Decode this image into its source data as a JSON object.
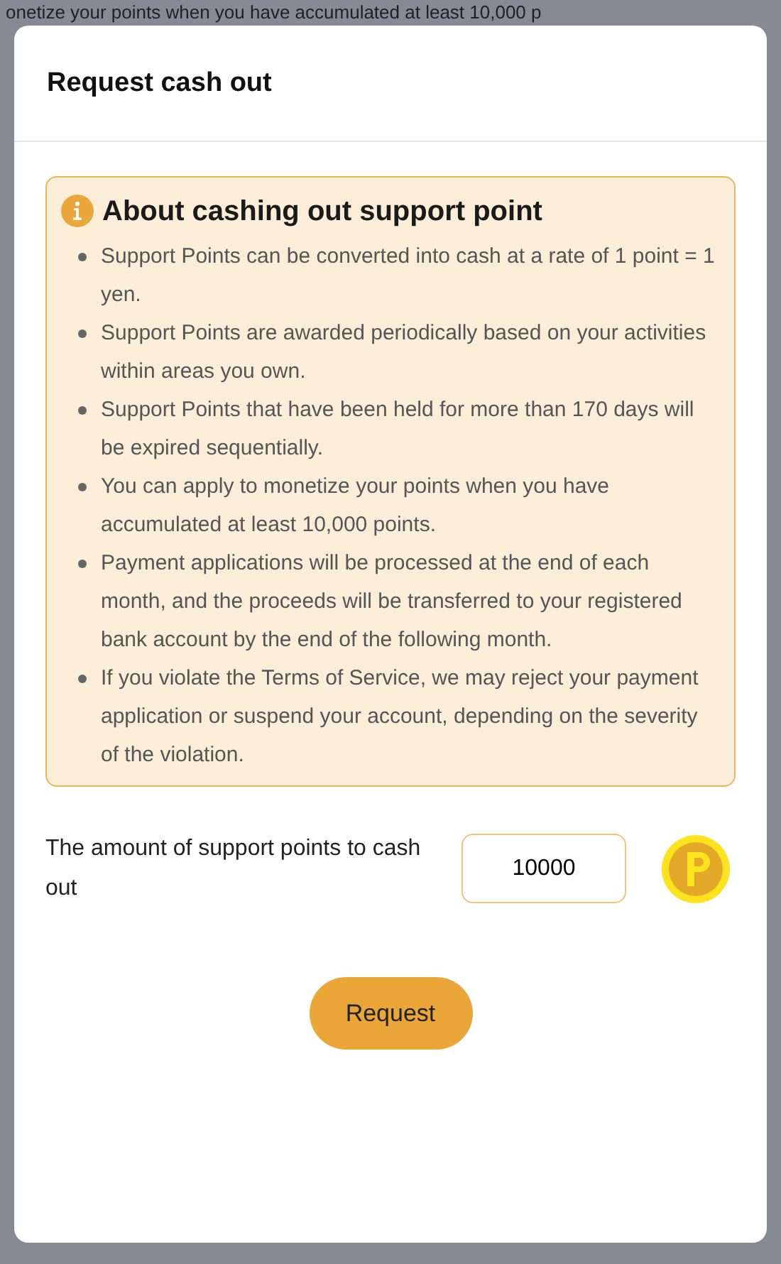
{
  "backdrop_text": "onetize your points when you have accumulated at least 10,000 p",
  "modal": {
    "title": "Request cash out",
    "notice": {
      "heading": "About cashing out support point",
      "items": [
        "Support Points can be converted into cash at a rate of 1 point = 1 yen.",
        "Support Points are awarded periodically based on your activities within areas you own.",
        "Support Points that have been held for more than 170 days will be expired sequentially.",
        "You can apply to monetize your points when you have accumulated at least 10,000 points.",
        "Payment applications will be processed at the end of each month, and the proceeds will be transferred to your registered bank account by the end of the following month.",
        "If you violate the Terms of Service, we may reject your payment application or suspend your account, depending on the severity of the violation."
      ]
    },
    "amount_label": "The amount of support points to cash out",
    "amount_value": "10000",
    "submit": "Request"
  }
}
